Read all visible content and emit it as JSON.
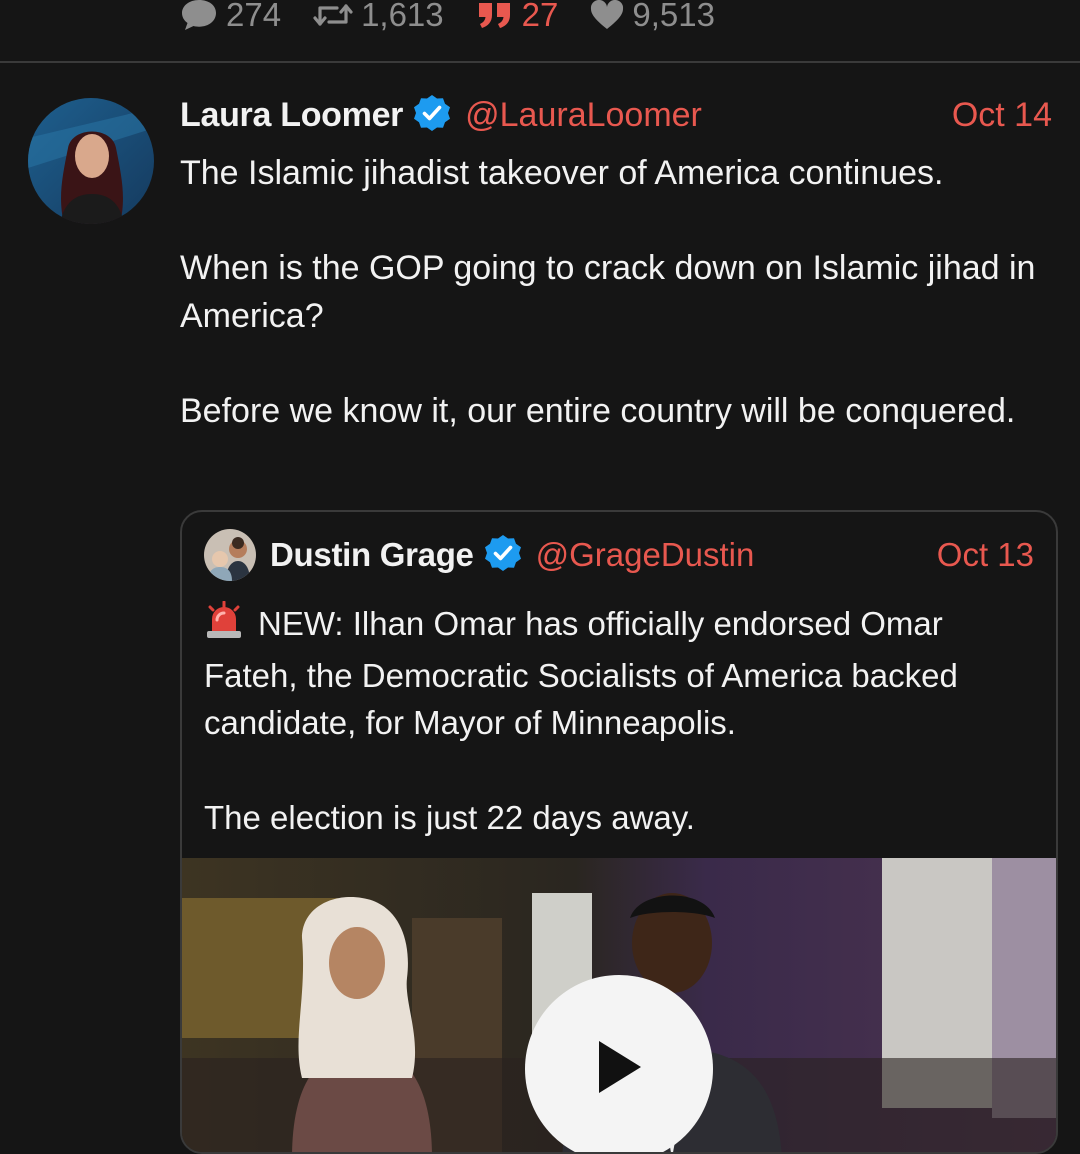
{
  "stats": {
    "replies": "274",
    "retweets": "1,613",
    "quotes": "27",
    "likes": "9,513"
  },
  "tweet": {
    "author_name": "Laura Loomer",
    "handle": "@LauraLoomer",
    "date": "Oct 14",
    "paragraphs": [
      "The Islamic jihadist takeover of America continues.",
      "When is the GOP going to crack down on Islamic jihad in America?",
      "Before we know it, our entire country will be conquered."
    ]
  },
  "quoted_tweet": {
    "author_name": "Dustin Grage",
    "handle": "@GrageDustin",
    "date": "Oct 13",
    "paragraphs": [
      "NEW: Ilhan Omar has officially endorsed Omar Fateh, the Democratic Socialists of America backed candidate, for Mayor of Minneapolis.",
      "The election is just 22 days away."
    ]
  },
  "icons": {
    "reply": "comment-icon",
    "retweet": "retweet-icon",
    "quote": "quote-icon",
    "like": "heart-icon",
    "verified": "verified-badge-icon",
    "alert": "rotating-light-icon",
    "play": "play-icon"
  },
  "colors": {
    "background": "#151515",
    "accent": "#e8584f",
    "verified": "#1d9bf0",
    "muted": "#8e8e8e",
    "text": "#f2f2f2"
  }
}
